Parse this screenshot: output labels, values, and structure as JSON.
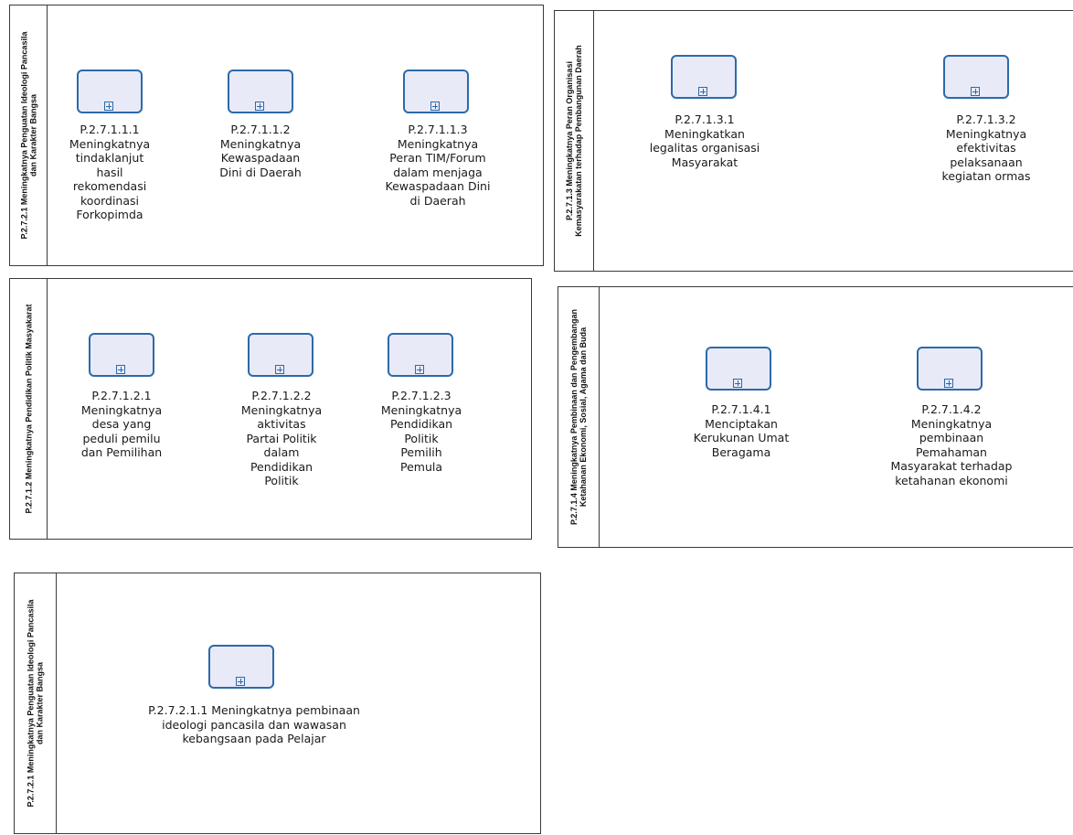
{
  "pools": [
    {
      "id": "p1",
      "lane_title": "P.2.7.2.1 Meningkatnya Penguatan Ideologi Pancasila\ndan Karakter Bangsa",
      "tasks": [
        {
          "label": "P.2.7.1.1.1\nMeningkatnya\ntindaklanjut\nhasil\nrekomendasi\nkoordinasi\nForkopimda"
        },
        {
          "label": "P.2.7.1.1.2\nMeningkatnya\nKewaspadaan\nDini di Daerah"
        },
        {
          "label": "P.2.7.1.1.3\nMeningkatnya\nPeran TIM/Forum\ndalam menjaga\nKewaspadaan Dini\ndi Daerah"
        }
      ]
    },
    {
      "id": "p2",
      "lane_title": "P.2.7.1.3 Meningkatnya Peran Organisasi\nKemasyarakatan terhadap Pembangunan Daerah",
      "tasks": [
        {
          "label": "P.2.7.1.3.1\nMeningkatkan\nlegalitas organisasi\nMasyarakat"
        },
        {
          "label": "P.2.7.1.3.2\nMeningkatnya\nefektivitas\npelaksanaan\nkegiatan ormas"
        }
      ]
    },
    {
      "id": "p3",
      "lane_title": "P.2.7.1.2 Meningkatnya Pendidikan Politik Masyakarat",
      "tasks": [
        {
          "label": "P.2.7.1.2.1\nMeningkatnya\ndesa yang\npeduli pemilu\ndan Pemilihan"
        },
        {
          "label": "P.2.7.1.2.2\nMeningkatnya\naktivitas\nPartai Politik\ndalam\nPendidikan\nPolitik"
        },
        {
          "label": "P.2.7.1.2.3\nMeningkatnya\nPendidikan\nPolitik\nPemilih\nPemula"
        }
      ]
    },
    {
      "id": "p4",
      "lane_title": "P.2.7.1.4 Meningkatnya Pembinaan dan Pengembangan\nKetahanan Ekonomi, Sosial, Agama dan Buda",
      "tasks": [
        {
          "label": "P.2.7.1.4.1\nMenciptakan\nKerukunan Umat\nBeragama"
        },
        {
          "label": "P.2.7.1.4.2\nMeningkatnya\npembinaan\nPemahaman\nMasyarakat terhadap\nketahanan ekonomi"
        }
      ]
    },
    {
      "id": "p5",
      "lane_title": "P.2.7.2.1 Meningkatnya Penguatan Ideologi Pancasila\ndan Karakter Bangsa",
      "tasks": [
        {
          "label": "P.2.7.2.1.1 Meningkatnya pembinaan\nideologi pancasila dan wawasan\nkebangsaan pada Pelajar"
        }
      ]
    }
  ],
  "colors": {
    "task_border": "#2c6aa8",
    "task_fill": "#e8eaf8",
    "pool_border": "#3a3a3a"
  }
}
